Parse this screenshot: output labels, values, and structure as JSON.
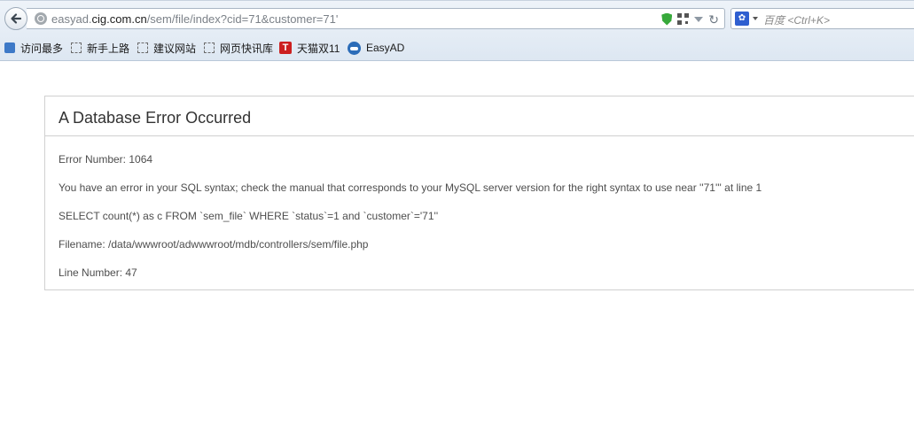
{
  "browser": {
    "url_host_prefix": "easyad.",
    "url_host": "cig.com.cn",
    "url_path": "/sem/file/index?cid=71&customer=71'",
    "search_placeholder": "百度 <Ctrl+K>",
    "reload_glyph": "↻",
    "engine_glyph": "✿"
  },
  "bookmarks": [
    {
      "label": "访问最多",
      "icon": "visited-icon"
    },
    {
      "label": "新手上路",
      "icon": "bookmark-icon"
    },
    {
      "label": "建议网站",
      "icon": "bookmark-icon"
    },
    {
      "label": "网页快讯库",
      "icon": "bookmark-icon"
    },
    {
      "label": "天猫双11",
      "icon": "tmall-icon",
      "icon_text": "T"
    },
    {
      "label": "EasyAD",
      "icon": "cloud-icon"
    }
  ],
  "error": {
    "title": "A Database Error Occurred",
    "number": "Error Number: 1064",
    "message": "You have an error in your SQL syntax; check the manual that corresponds to your MySQL server version for the right syntax to use near ''71''' at line 1",
    "query": "SELECT count(*) as c FROM `sem_file` WHERE `status`=1 and `customer`='71''",
    "filename": "Filename: /data/wwwroot/adwwwroot/mdb/controllers/sem/file.php",
    "line": "Line Number: 47"
  }
}
